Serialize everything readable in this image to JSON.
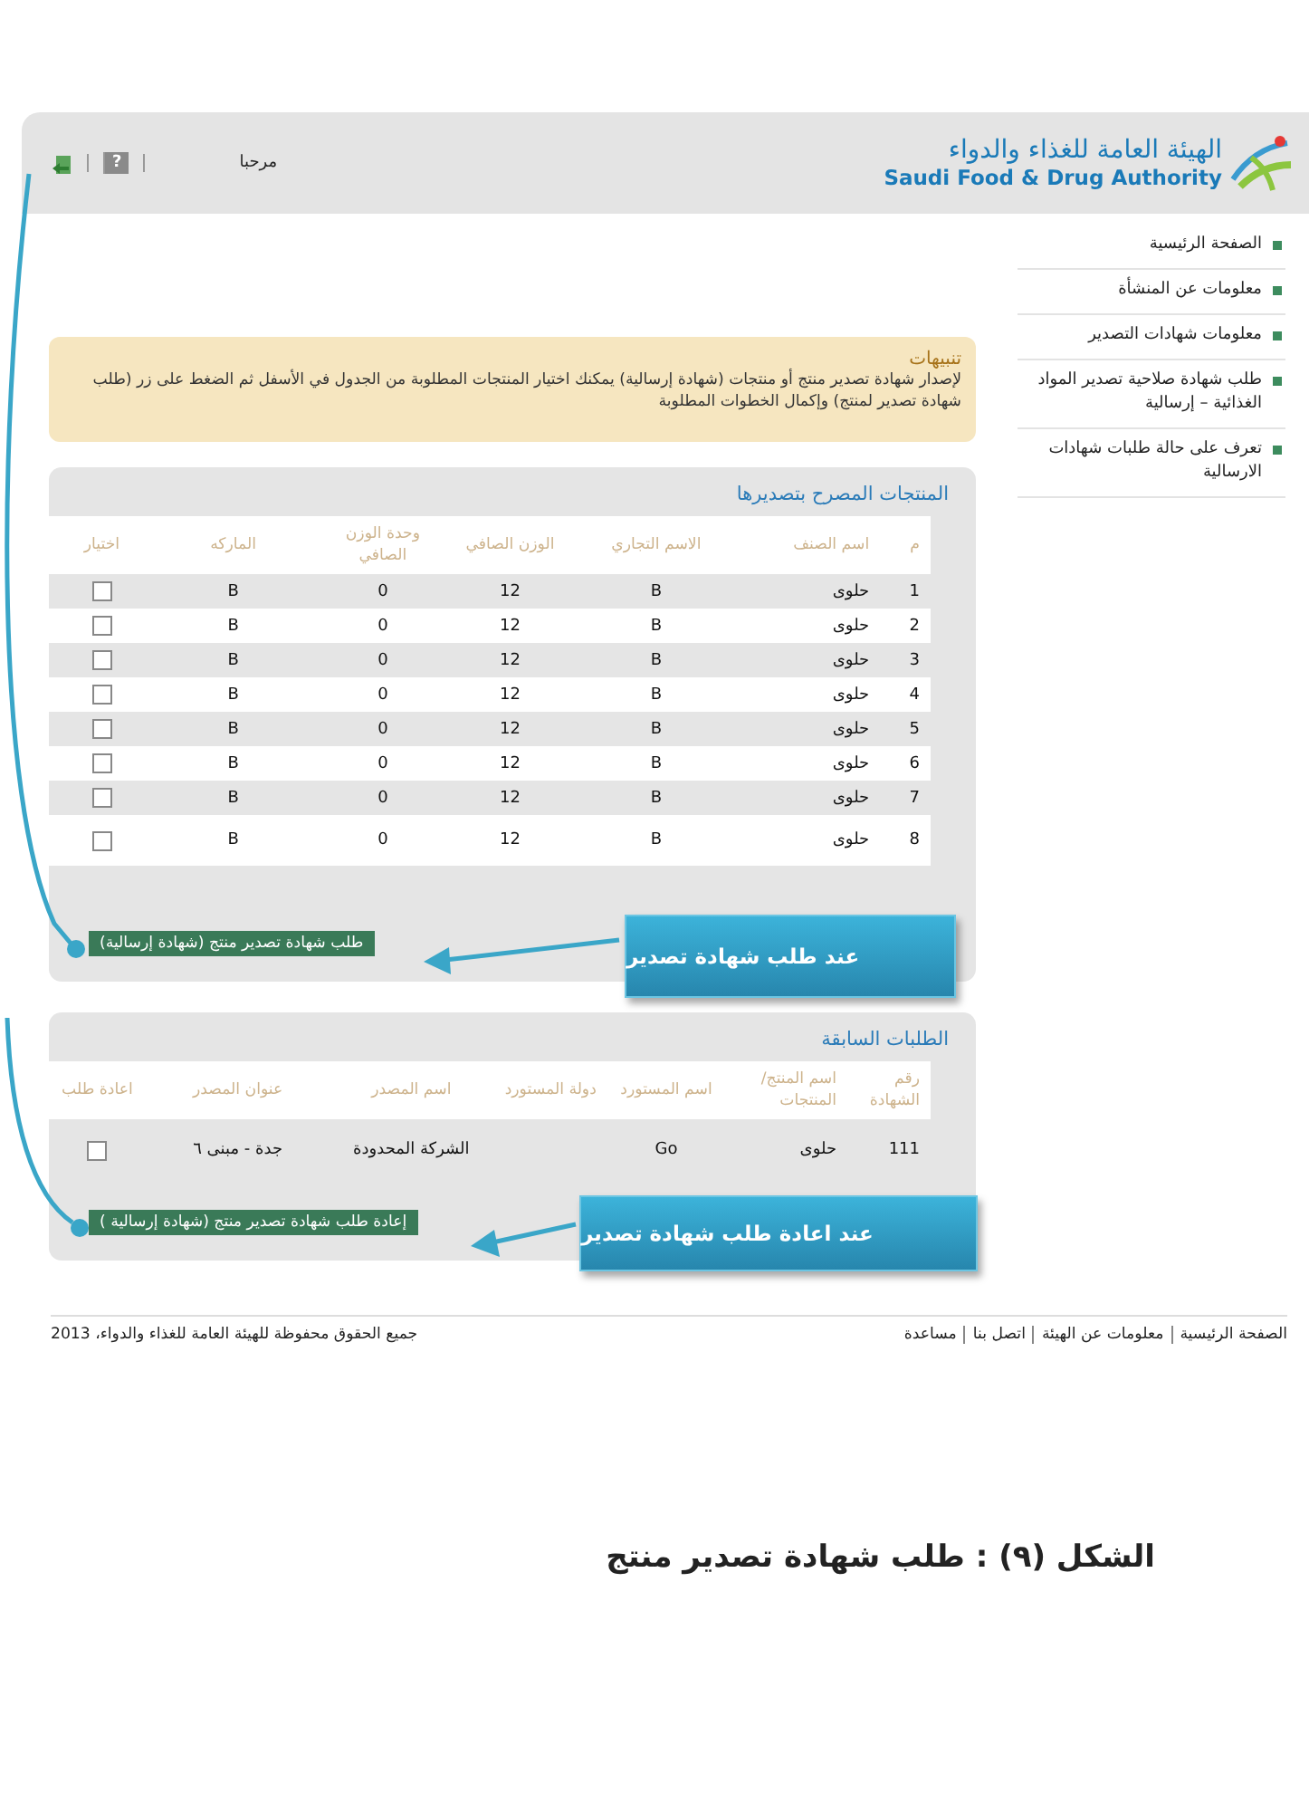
{
  "header": {
    "logo_arabic": "الهيئة العامة للغذاء والدواء",
    "logo_english": "Saudi Food & Drug Authority",
    "greeting": "مرحبا",
    "help_key": "?"
  },
  "sidebar": {
    "items": [
      {
        "label": "الصفحة الرئيسية"
      },
      {
        "label": "معلومات عن المنشأة"
      },
      {
        "label": "معلومات شهادات التصدير"
      },
      {
        "label": "طلب شهادة صلاحية تصدير المواد الغذائية – إرسالية"
      },
      {
        "label": "تعرف على حالة طلبات شهادات الارسالية"
      }
    ]
  },
  "notice": {
    "title": "تنبيهات",
    "text": "لإصدار شهادة تصدير منتج أو منتجات (شهادة إرسالية) يمكنك اختيار المنتجات المطلوبة من الجدول في الأسفل ثم الضغط على زر (طلب شهادة تصدير لمنتج) وإكمال الخطوات المطلوبة"
  },
  "products": {
    "title": "المنتجات المصرح بتصديرها",
    "columns": [
      "م",
      "اسم الصنف",
      "الاسم التجاري",
      "الوزن الصافي",
      "وحدة الوزن الصافي",
      "الماركه",
      "اختيار"
    ],
    "rows": [
      {
        "cells": [
          "1",
          "حلوى",
          "B",
          "12",
          "0",
          "B"
        ],
        "checked": false
      },
      {
        "cells": [
          "2",
          "حلوى",
          "B",
          "12",
          "0",
          "B"
        ],
        "checked": false
      },
      {
        "cells": [
          "3",
          "حلوى",
          "B",
          "12",
          "0",
          "B"
        ],
        "checked": false
      },
      {
        "cells": [
          "4",
          "حلوى",
          "B",
          "12",
          "0",
          "B"
        ],
        "checked": false
      },
      {
        "cells": [
          "5",
          "حلوى",
          "B",
          "12",
          "0",
          "B"
        ],
        "checked": false
      },
      {
        "cells": [
          "6",
          "حلوى",
          "B",
          "12",
          "0",
          "B"
        ],
        "checked": false
      },
      {
        "cells": [
          "7",
          "حلوى",
          "B",
          "12",
          "0",
          "B"
        ],
        "checked": false
      },
      {
        "cells": [
          "8",
          "حلوى",
          "B",
          "12",
          "0",
          "B"
        ],
        "checked": false
      }
    ],
    "button": "طلب شهادة تصدير منتج (شهادة إرسالية)"
  },
  "previous": {
    "title": "الطلبات السابقة",
    "columns": [
      "رقم الشهادة",
      "اسم المنتج/ المنتجات",
      "اسم المستورد",
      "دولة المستورد",
      "اسم المصدر",
      "عنوان المصدر",
      "اعادة طلب"
    ],
    "rows": [
      {
        "cells": [
          "111",
          "حلوى",
          "Go",
          null,
          "الشركة المحدودة",
          "جدة - مبنى ٦"
        ],
        "checked": false
      }
    ],
    "button": "إعادة طلب شهادة تصدير منتج (شهادة إرسالية )"
  },
  "callouts": [
    {
      "text": "عند طلب شهادة تصدير"
    },
    {
      "text": "عند اعادة طلب شهادة تصدير"
    }
  ],
  "footer": {
    "links": [
      "الصفحة الرئيسية",
      "معلومات عن الهيئة",
      "اتصل بنا",
      "مساعدة"
    ],
    "copyright": "جميع الحقوق محفوظة للهيئة العامة للغذاء والدواء، 2013"
  },
  "caption": "الشكل (٩) : طلب شهادة تصدير منتج"
}
